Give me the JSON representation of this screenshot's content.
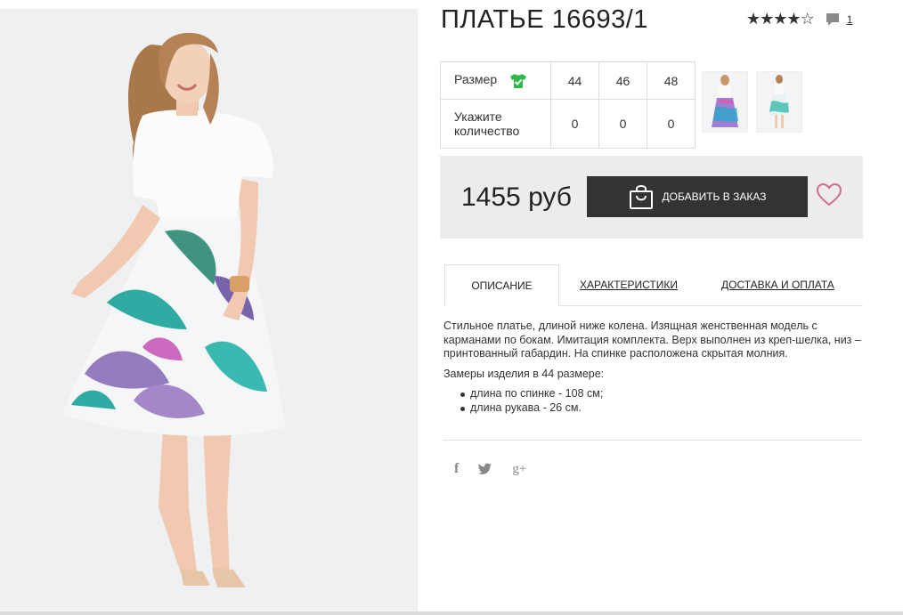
{
  "product": {
    "title": "ПЛАТЬЕ 16693/1",
    "rating_stars_filled": 4,
    "rating_stars_total": 5,
    "comments_count": "1"
  },
  "size_table": {
    "size_label": "Размер",
    "sizes": [
      "44",
      "46",
      "48"
    ],
    "qty_label_line1": "Укажите",
    "qty_label_line2": "количество",
    "quantities": [
      "0",
      "0",
      "0"
    ]
  },
  "buy": {
    "price": "1455 руб",
    "order_button": "ДОБАВИТЬ В ЗАКАЗ"
  },
  "tabs": [
    {
      "label": "ОПИСАНИЕ",
      "active": true
    },
    {
      "label": "ХАРАКТЕРИСТИКИ",
      "active": false
    },
    {
      "label": "ДОСТАВКА И ОПЛАТА",
      "active": false
    }
  ],
  "description": {
    "paragraph": "Стильное платье, длиной ниже колена. Изящная женственная модель с карманами по бокам. Имитация комплекта. Верх выполнен из креп-шелка, низ – принтованный габардин. На спинке расположена скрытая молния.",
    "measures_title": "Замеры изделия в 44 размере:",
    "measures": [
      "длина по спинке - 108 см;",
      "длина рукава - 26 см."
    ]
  },
  "share": {
    "facebook": "f",
    "twitter": "twitter-icon",
    "googleplus": "g+"
  },
  "colors": {
    "button_bg": "#333333",
    "buybox_bg": "#ececec",
    "heart": "#d36b8c",
    "check_green": "#2eb84a",
    "photo_bg": "#eff0f2"
  }
}
